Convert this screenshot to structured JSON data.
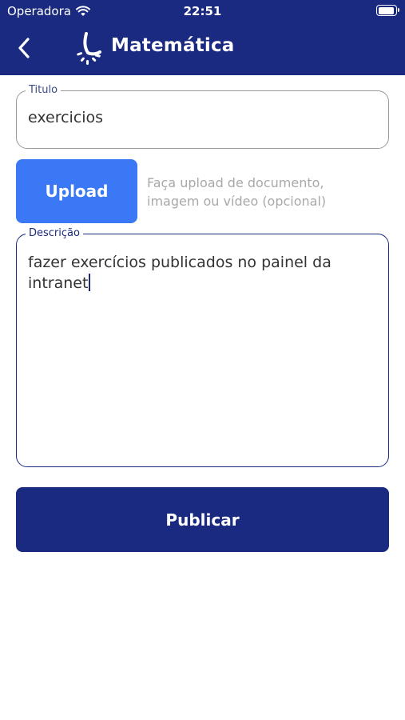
{
  "status_bar": {
    "carrier": "Operadora",
    "time": "22:51",
    "battery_level": 0.95
  },
  "nav": {
    "title": "Matemática",
    "back_icon": "chevron-left-icon",
    "logo_icon": "app-logo-icon"
  },
  "form": {
    "title_label": "Titulo",
    "title_value": "exercicios",
    "upload_label": "Upload",
    "upload_hint_line1": "Faça upload de documento,",
    "upload_hint_line2": "imagem ou vídeo (opcional)",
    "description_label": "Descrição",
    "description_value": "fazer exercícios publicados no painel da\nintranet",
    "publish_label": "Publicar"
  },
  "colors": {
    "header": "#1a2a80",
    "upload_button": "#3b78f5",
    "publish_button": "#1a2a80",
    "hint_text": "#a8a8a8"
  }
}
